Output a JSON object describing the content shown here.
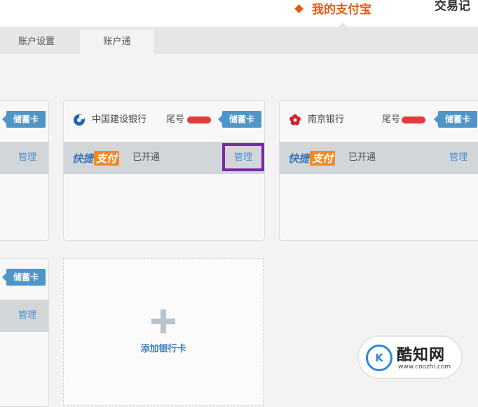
{
  "nav": {
    "active_label": "我的支付宝",
    "next_label": "交易记"
  },
  "subtabs": [
    "账户设置",
    "账户通"
  ],
  "common": {
    "debit_badge": "储蓄卡",
    "tail_label": "尾号",
    "manage": "管理",
    "kuaijie_a": "快捷",
    "kuaijie_b": "支付",
    "opened": "已开通"
  },
  "cards": [
    {
      "bank_name": "中国建设银行",
      "logo_icon": "ccb-logo-icon",
      "logo_color": "#1f63b5"
    },
    {
      "bank_name": "南京银行",
      "logo_icon": "nanjing-bank-logo-icon",
      "logo_color": "#d6202b"
    }
  ],
  "add_card": {
    "label": "添加银行卡"
  },
  "watermark": {
    "name": "酷知网",
    "url": "www.coozhi.com"
  },
  "colors": {
    "accent": "#e55b10",
    "link": "#4a8fcf",
    "badge": "#4f95c8",
    "highlight": "#7a2aa8"
  }
}
